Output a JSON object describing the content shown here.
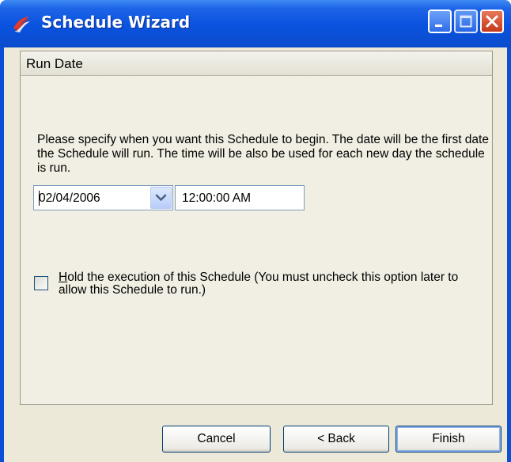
{
  "window": {
    "title": "Schedule Wizard",
    "icon": "schedule-app-icon",
    "controls": {
      "minimize": "minimize-icon",
      "maximize": "maximize-icon",
      "close": "close-icon"
    },
    "colors": {
      "titlebar": "#0a52de",
      "client": "#ece9d8"
    }
  },
  "page": {
    "header": "Run Date",
    "description": "Please specify when you want this Schedule to begin. The date will be the first date the Schedule will run. The time will be also be used for each new day the schedule is run.",
    "date": {
      "value": "02/04/2006",
      "dropdown_icon": "chevron-down-icon"
    },
    "time": {
      "value": "12:00:00 AM"
    },
    "hold": {
      "checked": false,
      "label_access_key": "H",
      "label_rest": "old the execution of this Schedule (You must uncheck this option later to allow this Schedule to run.)"
    }
  },
  "buttons": {
    "cancel": "Cancel",
    "back": "< Back",
    "finish": "Finish"
  }
}
